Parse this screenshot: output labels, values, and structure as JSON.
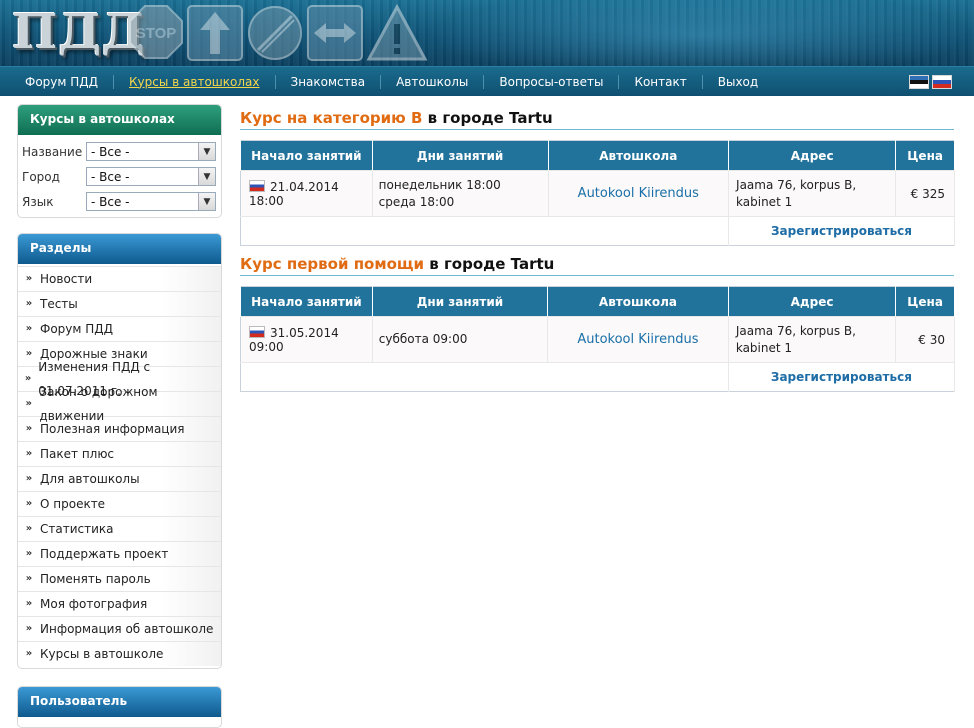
{
  "header": {
    "logo_text": "ПДД",
    "signs": [
      "stop-sign-icon",
      "arrow-up-sign-icon",
      "no-limit-sign-icon",
      "two-way-arrow-sign-icon",
      "warning-sign-icon"
    ]
  },
  "nav": {
    "items": [
      {
        "label": "Форум ПДД",
        "active": false
      },
      {
        "label": "Курсы в автошколах",
        "active": true
      },
      {
        "label": "Знакомства",
        "active": false
      },
      {
        "label": "Автошколы",
        "active": false
      },
      {
        "label": "Вопросы-ответы",
        "active": false
      },
      {
        "label": "Контакт",
        "active": false
      },
      {
        "label": "Выход",
        "active": false
      }
    ],
    "languages": [
      "estonian-flag-icon",
      "russian-flag-icon"
    ]
  },
  "sidebar": {
    "filter": {
      "title": "Курсы в автошколах",
      "rows": [
        {
          "label": "Название",
          "value": "- Все -"
        },
        {
          "label": "Город",
          "value": "- Все -"
        },
        {
          "label": "Язык",
          "value": "- Все -"
        }
      ]
    },
    "sections": {
      "title": "Разделы",
      "items": [
        "Новости",
        "Тесты",
        "Форум ПДД",
        "Дорожные знаки",
        "Изменения ПДД с 01.07.2011 г.",
        "Закон о дорожном движении",
        "Полезная информация",
        "Пакет плюс",
        "Для автошколы",
        "О проекте",
        "Статистика",
        "Поддержать проект",
        "Поменять пароль",
        "Моя фотография",
        "Информация об автошколе",
        "Курсы в автошколе"
      ]
    },
    "user": {
      "title": "Пользователь"
    }
  },
  "main": {
    "columns": [
      "Начало занятий",
      "Дни занятий",
      "Автошкола",
      "Адрес",
      "Цена"
    ],
    "courses": [
      {
        "title_highlight": "Курс на категорию B",
        "title_rest": " в городе Tartu",
        "start": "21.04.2014 18:00",
        "days_line1": "понедельник 18:00",
        "days_line2": "среда 18:00",
        "school": "Autokool Kiirendus",
        "address_line1": "Jaama 76, korpus B,",
        "address_line2": "kabinet 1",
        "price": "€ 325",
        "register": "Зарегистрироваться"
      },
      {
        "title_highlight": "Курс первой помощи",
        "title_rest": " в городе Tartu",
        "start": "31.05.2014 09:00",
        "days_line1": "суббота 09:00",
        "days_line2": "",
        "school": "Autokool Kiirendus",
        "address_line1": "Jaama 76, korpus B,",
        "address_line2": "kabinet 1",
        "price": "€ 30",
        "register": "Зарегистрироваться"
      }
    ]
  }
}
